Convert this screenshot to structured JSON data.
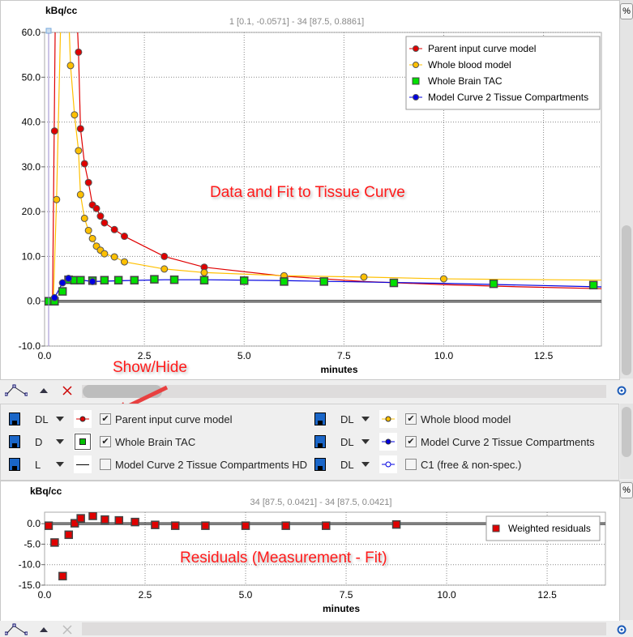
{
  "top_chart": {
    "ylabel": "kBq/cc",
    "xlabel": "minutes",
    "info": "1 [0.1, -0.0571] - 34 [87.5, 0.8861]",
    "annotation": "Data and Fit to Tissue Curve",
    "percent_button": "%"
  },
  "bottom_chart": {
    "ylabel": "kBq/cc",
    "xlabel": "minutes",
    "info": "34 [87.5, 0.0421] - 34 [87.5, 0.0421]",
    "annotation": "Residuals (Measurement - Fit)",
    "percent_button": "%"
  },
  "show_hide_label": "Show/Hide",
  "curve_controls": [
    {
      "mode": "DL",
      "label": "Parent input curve model",
      "checked": true,
      "color": "#e00000",
      "symbol": "circle"
    },
    {
      "mode": "DL",
      "label": "Whole blood model",
      "checked": true,
      "color": "#ffc000",
      "symbol": "circle"
    },
    {
      "mode": "D",
      "label": "Whole Brain TAC",
      "checked": true,
      "color": "#00c000",
      "symbol": "square"
    },
    {
      "mode": "DL",
      "label": "Model Curve 2 Tissue Compartments",
      "checked": true,
      "color": "#0000e0",
      "symbol": "circle"
    },
    {
      "mode": "L",
      "label": "Model Curve 2 Tissue Compartments HD",
      "checked": false,
      "color": "#000000",
      "symbol": "line"
    },
    {
      "mode": "DL",
      "label": "C1 (free & non-spec.)",
      "checked": false,
      "color": "#0000e0",
      "symbol": "open-circle"
    }
  ],
  "chart_data": [
    {
      "type": "line",
      "title": "",
      "xlabel": "minutes",
      "ylabel": "kBq/cc",
      "xlim": [
        0,
        13.95
      ],
      "ylim": [
        -10,
        60
      ],
      "xticks": [
        "0.0",
        "2.5",
        "5.0",
        "7.5",
        "10.0",
        "12.5"
      ],
      "yticks": [
        "-10.0",
        "0.0",
        "10.0",
        "20.0",
        "30.0",
        "40.0",
        "50.0",
        "60.0"
      ],
      "grid": true,
      "legend": "top-right",
      "series": [
        {
          "name": "Parent input curve model",
          "color": "#e00000",
          "marker": "circle",
          "points": [
            [
              0.05,
              0
            ],
            [
              0.25,
              38
            ],
            [
              0.85,
              55.6
            ],
            [
              0.9,
              38.5
            ],
            [
              1.0,
              30.7
            ],
            [
              1.1,
              26.5
            ],
            [
              1.2,
              21.5
            ],
            [
              1.3,
              20.7
            ],
            [
              1.4,
              19
            ],
            [
              1.5,
              17.5
            ],
            [
              1.75,
              16
            ],
            [
              2.0,
              14.5
            ],
            [
              3.0,
              10
            ],
            [
              4.0,
              7.6
            ]
          ],
          "line": [
            [
              0,
              0
            ],
            [
              0.2,
              0
            ],
            [
              0.27,
              65
            ],
            [
              0.4,
              90
            ],
            [
              0.6,
              90
            ],
            [
              0.8,
              66
            ],
            [
              0.85,
              55.6
            ],
            [
              0.9,
              38.5
            ],
            [
              1.0,
              30.7
            ],
            [
              1.1,
              26.5
            ],
            [
              1.2,
              21.5
            ],
            [
              1.3,
              20.7
            ],
            [
              1.4,
              19
            ],
            [
              1.5,
              17.5
            ],
            [
              1.75,
              16
            ],
            [
              2.0,
              14.5
            ],
            [
              3.0,
              10
            ],
            [
              4.0,
              7.6
            ],
            [
              6,
              5.6
            ],
            [
              8,
              4.4
            ],
            [
              10,
              3.7
            ],
            [
              12,
              3.2
            ],
            [
              14,
              2.8
            ]
          ]
        },
        {
          "name": "Whole blood model",
          "color": "#ffc000",
          "marker": "circle",
          "points": [
            [
              0,
              0
            ],
            [
              0.3,
              22.7
            ],
            [
              0.65,
              52.6
            ],
            [
              0.75,
              41.6
            ],
            [
              0.85,
              33.6
            ],
            [
              0.9,
              23.8
            ],
            [
              1.0,
              18.5
            ],
            [
              1.1,
              15.8
            ],
            [
              1.2,
              14
            ],
            [
              1.3,
              12.3
            ],
            [
              1.4,
              11.4
            ],
            [
              1.5,
              10.6
            ],
            [
              1.75,
              9.9
            ],
            [
              2.0,
              8.8
            ],
            [
              3.0,
              7.2
            ],
            [
              4.0,
              6.4
            ],
            [
              6.0,
              5.7
            ],
            [
              8.0,
              5.4
            ],
            [
              10.0,
              5.0
            ]
          ],
          "line": [
            [
              0,
              0
            ],
            [
              0.22,
              0
            ],
            [
              0.3,
              22.7
            ],
            [
              0.45,
              80
            ],
            [
              0.6,
              65
            ],
            [
              0.65,
              52.6
            ],
            [
              0.75,
              41.6
            ],
            [
              0.85,
              33.6
            ],
            [
              0.9,
              23.8
            ],
            [
              1.0,
              18.5
            ],
            [
              1.1,
              15.8
            ],
            [
              1.2,
              14
            ],
            [
              1.3,
              12.3
            ],
            [
              1.4,
              11.4
            ],
            [
              1.5,
              10.6
            ],
            [
              1.75,
              9.9
            ],
            [
              2.0,
              8.8
            ],
            [
              3.0,
              7.2
            ],
            [
              4.0,
              6.4
            ],
            [
              6.0,
              5.7
            ],
            [
              8.0,
              5.4
            ],
            [
              10.0,
              5.0
            ],
            [
              14,
              4.7
            ]
          ]
        },
        {
          "name": "Whole Brain TAC",
          "color": "#00e000",
          "marker": "square",
          "points": [
            [
              0.05,
              0
            ],
            [
              0.1,
              0
            ],
            [
              0.25,
              0
            ],
            [
              0.45,
              2.2
            ],
            [
              0.6,
              4.8
            ],
            [
              0.75,
              4.7
            ],
            [
              0.9,
              4.7
            ],
            [
              1.2,
              4.6
            ],
            [
              1.5,
              4.7
            ],
            [
              1.85,
              4.7
            ],
            [
              2.25,
              4.7
            ],
            [
              2.75,
              4.9
            ],
            [
              3.25,
              4.8
            ],
            [
              4.0,
              4.7
            ],
            [
              5.0,
              4.6
            ],
            [
              6.0,
              4.4
            ],
            [
              7.0,
              4.4
            ],
            [
              8.75,
              4.1
            ],
            [
              11.25,
              3.9
            ],
            [
              13.75,
              3.6
            ]
          ],
          "line": []
        },
        {
          "name": "Model Curve 2 Tissue Compartments",
          "color": "#0000e0",
          "marker": "circle",
          "points": [
            [
              0.25,
              0.8
            ],
            [
              0.45,
              4.1
            ],
            [
              0.6,
              5.1
            ],
            [
              1.2,
              4.4
            ]
          ],
          "line": [
            [
              0,
              0
            ],
            [
              0.2,
              0
            ],
            [
              0.25,
              0.8
            ],
            [
              0.45,
              4.1
            ],
            [
              0.6,
              5.1
            ],
            [
              1.2,
              4.4
            ],
            [
              2,
              4.6
            ],
            [
              3,
              4.8
            ],
            [
              4,
              4.8
            ],
            [
              6,
              4.6
            ],
            [
              8,
              4.3
            ],
            [
              10,
              4.0
            ],
            [
              12,
              3.6
            ],
            [
              14,
              3.2
            ]
          ]
        }
      ]
    },
    {
      "type": "scatter",
      "title": "",
      "xlabel": "minutes",
      "ylabel": "kBq/cc",
      "xlim": [
        0,
        13.95
      ],
      "ylim": [
        -15,
        2.8
      ],
      "xticks": [
        "0.0",
        "2.5",
        "5.0",
        "7.5",
        "10.0",
        "12.5"
      ],
      "yticks": [
        "-15.0",
        "-10.0",
        "-5.0",
        "0.0"
      ],
      "grid": true,
      "legend": "top-right",
      "series": [
        {
          "name": "Weighted residuals",
          "color": "#e00000",
          "marker": "square",
          "points": [
            [
              0.1,
              -0.5
            ],
            [
              0.25,
              -4.6
            ],
            [
              0.45,
              -12.8
            ],
            [
              0.6,
              -2.7
            ],
            [
              0.75,
              0.1
            ],
            [
              0.9,
              1.3
            ],
            [
              1.2,
              1.9
            ],
            [
              1.5,
              1.0
            ],
            [
              1.85,
              0.8
            ],
            [
              2.25,
              0.4
            ],
            [
              2.75,
              -0.3
            ],
            [
              3.25,
              -0.5
            ],
            [
              4.0,
              -0.5
            ],
            [
              5.0,
              -0.5
            ],
            [
              6.0,
              -0.5
            ],
            [
              7.0,
              -0.5
            ],
            [
              8.75,
              -0.2
            ]
          ]
        }
      ]
    }
  ]
}
